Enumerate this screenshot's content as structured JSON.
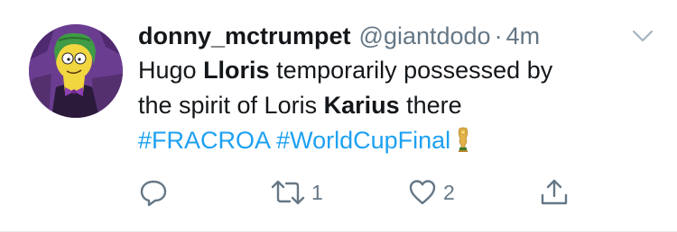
{
  "tweet": {
    "display_name": "donny_mctrumpet",
    "handle": "@giantdodo",
    "separator": "·",
    "time": "4m",
    "text": {
      "line1_a": "Hugo ",
      "line1_bold": "Lloris",
      "line1_b": " temporarily possessed by",
      "line2_a": "the spirit of Loris ",
      "line2_bold": "Karius",
      "line2_b": " there",
      "hashtag1": "#FRACROA",
      "hashtag2": "#WorldCupFinal"
    },
    "actions": {
      "retweet_count": "1",
      "like_count": "2"
    }
  },
  "colors": {
    "link": "#1da1f2",
    "muted": "#657786",
    "text": "#14171a"
  },
  "icons": {
    "more": "chevron-down-icon",
    "reply": "reply-icon",
    "retweet": "retweet-icon",
    "like": "heart-icon",
    "share": "share-icon",
    "emoji": "trophy-icon"
  }
}
